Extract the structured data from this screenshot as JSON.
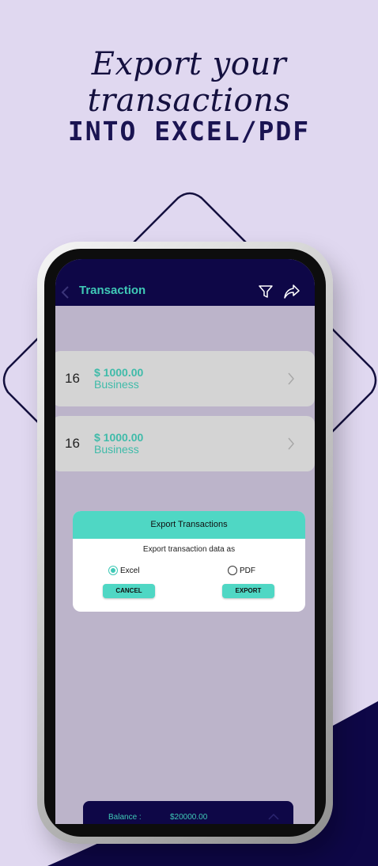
{
  "headline": {
    "line1": "Export your transactions",
    "line2": "INTO EXCEL/PDF"
  },
  "colors": {
    "background": "#e0d8f0",
    "navy": "#0e0747",
    "accent": "#3fc9b6",
    "dialog_accent": "#4fd7c4"
  },
  "app": {
    "header": {
      "title": "Transaction",
      "icons": [
        "chevron-left-icon",
        "filter-icon",
        "share-icon"
      ]
    },
    "transactions": [
      {
        "day": "16",
        "amount": "$ 1000.00",
        "category": "Business"
      },
      {
        "day": "16",
        "amount": "$ 1000.00",
        "category": "Business"
      }
    ],
    "export_dialog": {
      "title": "Export Transactions",
      "prompt": "Export transaction data as",
      "options": [
        {
          "label": "Excel",
          "selected": true
        },
        {
          "label": "PDF",
          "selected": false
        }
      ],
      "cancel_label": "CANCEL",
      "export_label": "EXPORT"
    },
    "balance": {
      "label": "Balance :",
      "value": "$20000.00"
    }
  }
}
